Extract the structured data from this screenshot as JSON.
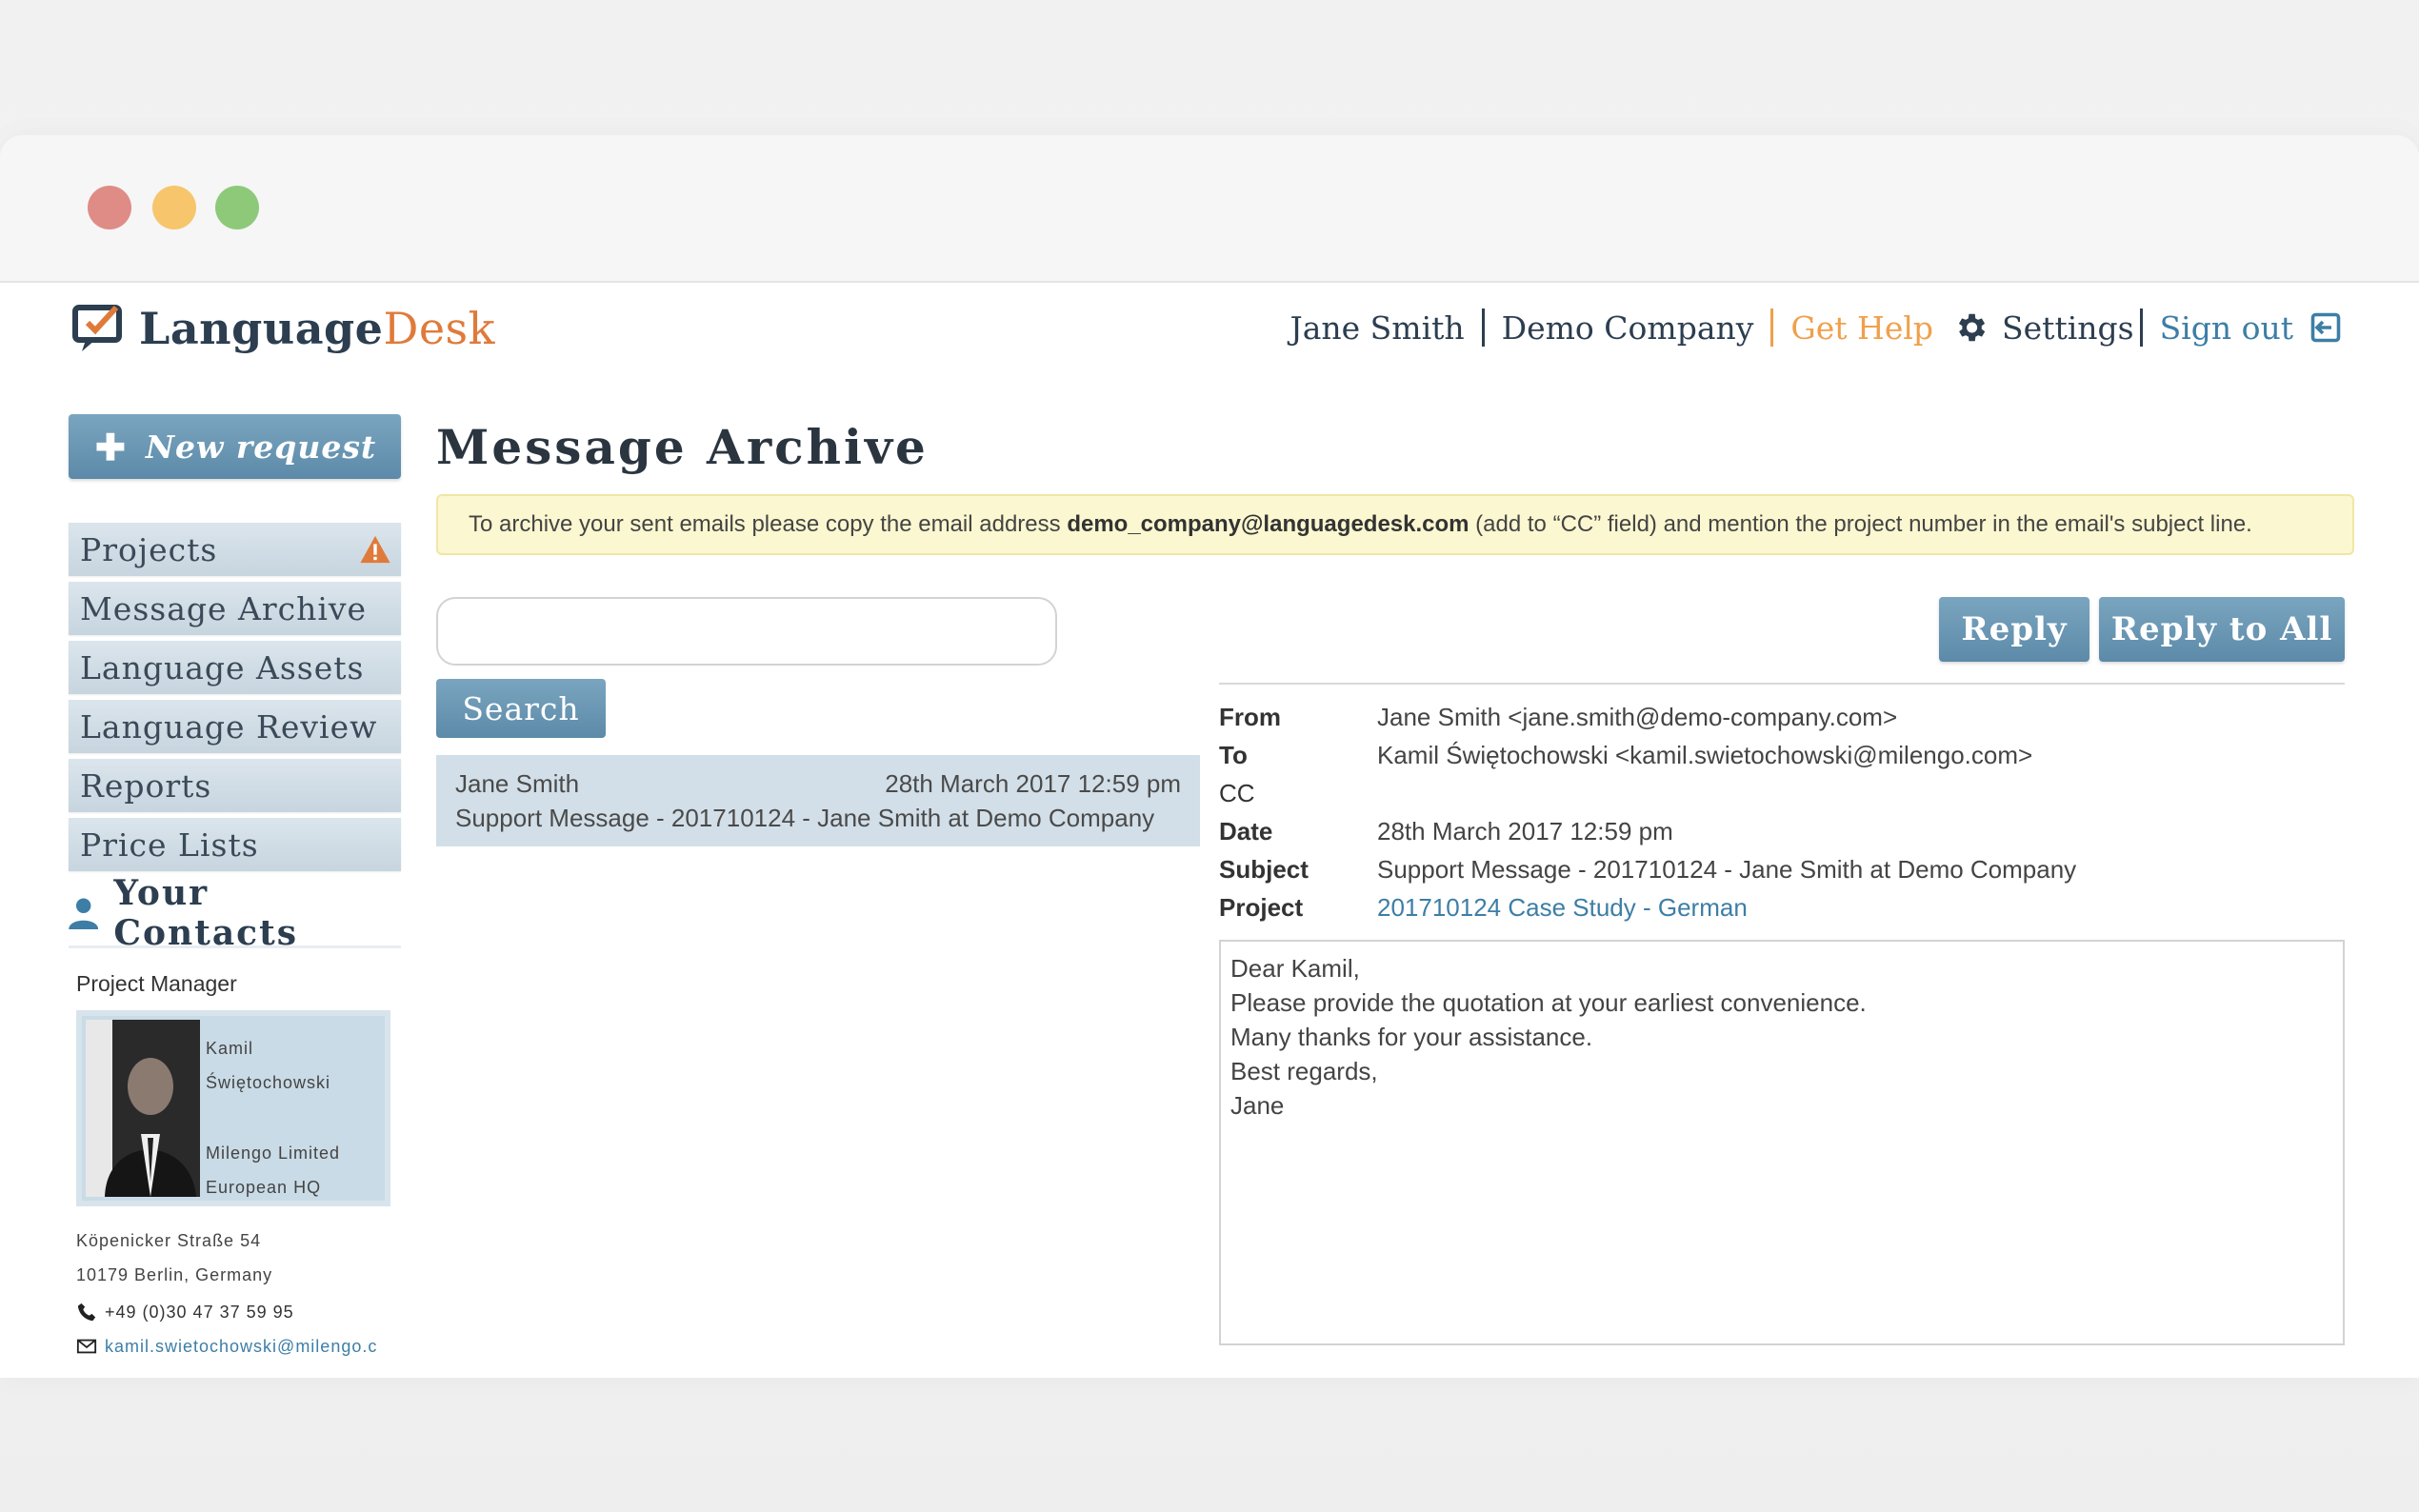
{
  "header": {
    "logo_part1": "Language",
    "logo_part2": "Desk",
    "user": "Jane Smith",
    "company": "Demo Company",
    "help": "Get Help",
    "settings": "Settings",
    "signout": "Sign out"
  },
  "sidebar": {
    "new_request": "New request",
    "items": [
      {
        "label": "Projects",
        "warning": true
      },
      {
        "label": "Message Archive"
      },
      {
        "label": "Language Assets"
      },
      {
        "label": "Language Review"
      },
      {
        "label": "Reports"
      },
      {
        "label": "Price Lists"
      }
    ],
    "contacts_title": "Your Contacts",
    "contact": {
      "role": "Project Manager",
      "first_name": "Kamil",
      "last_name": "Świętochowski",
      "org1": "Milengo Limited",
      "org2": "European HQ",
      "street": "Köpenicker Straße 54",
      "city": "10179 Berlin, Germany",
      "phone": "+49 (0)30 47 37 59 95",
      "email": "kamil.swietochowski@milengo.c"
    }
  },
  "main": {
    "title": "Message Archive",
    "notice_pre": "To archive your sent emails please copy the email address ",
    "notice_email": "demo_company@languagedesk.com",
    "notice_post": " (add to “CC” field) and mention the project number in the email's subject line.",
    "search_placeholder": "",
    "search_button": "Search",
    "reply_button": "Reply",
    "reply_all_button": "Reply to All",
    "messages": [
      {
        "sender": "Jane Smith",
        "date": "28th March 2017 12:59 pm",
        "subject": "Support Message - 201710124 - Jane Smith at Demo Company"
      }
    ],
    "detail": {
      "from_label": "From",
      "from": "Jane Smith <jane.smith@demo-company.com>",
      "to_label": "To",
      "to": "Kamil Świętochowski <kamil.swietochowski@milengo.com>",
      "cc_label": "CC",
      "cc": "",
      "date_label": "Date",
      "date": "28th March 2017 12:59 pm",
      "subject_label": "Subject",
      "subject": "Support Message - 201710124 - Jane Smith at Demo Company",
      "project_label": "Project",
      "project": "201710124 Case Study - German",
      "body": [
        "Dear Kamil,",
        "Please provide the quotation at your earliest convenience.",
        "Many thanks for your assistance.",
        "Best regards,",
        "Jane"
      ]
    }
  },
  "colors": {
    "accent_blue": "#5c8aa8",
    "brand_orange": "#e07a3a",
    "help_orange": "#f0a04b",
    "link_blue": "#3d7ea6"
  }
}
